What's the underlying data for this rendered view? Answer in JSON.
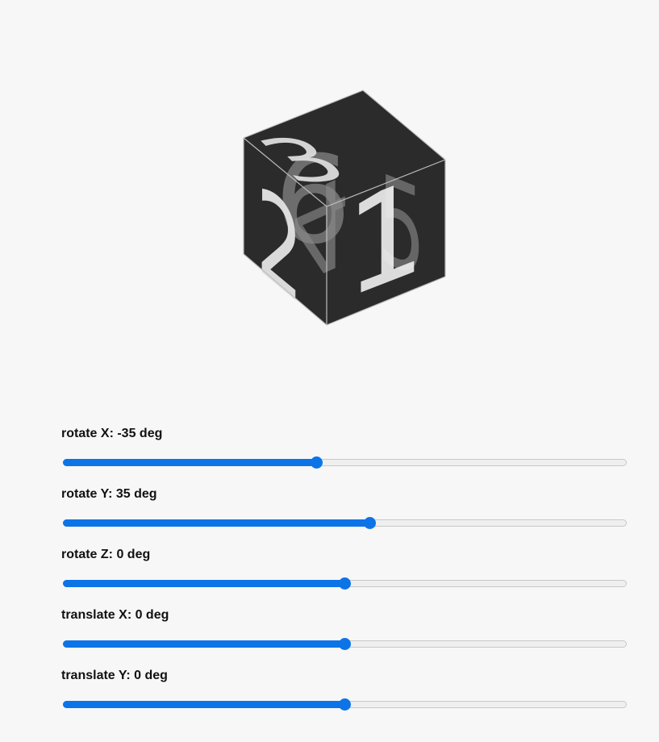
{
  "cube": {
    "faces": [
      "1",
      "2",
      "3",
      "4",
      "5",
      "6"
    ],
    "face_color": "#2b2b2b",
    "edge_color": "#bdbdbd"
  },
  "accent_color": "#0d74e8",
  "controls": [
    {
      "label": "rotate X: -35 deg",
      "level": 0.45
    },
    {
      "label": "rotate Y: 35 deg",
      "level": 0.545
    },
    {
      "label": "rotate Z: 0 deg",
      "level": 0.5
    },
    {
      "label": "translate X: 0 deg",
      "level": 0.5
    },
    {
      "label": "translate Y: 0 deg",
      "level": 0.5
    }
  ]
}
